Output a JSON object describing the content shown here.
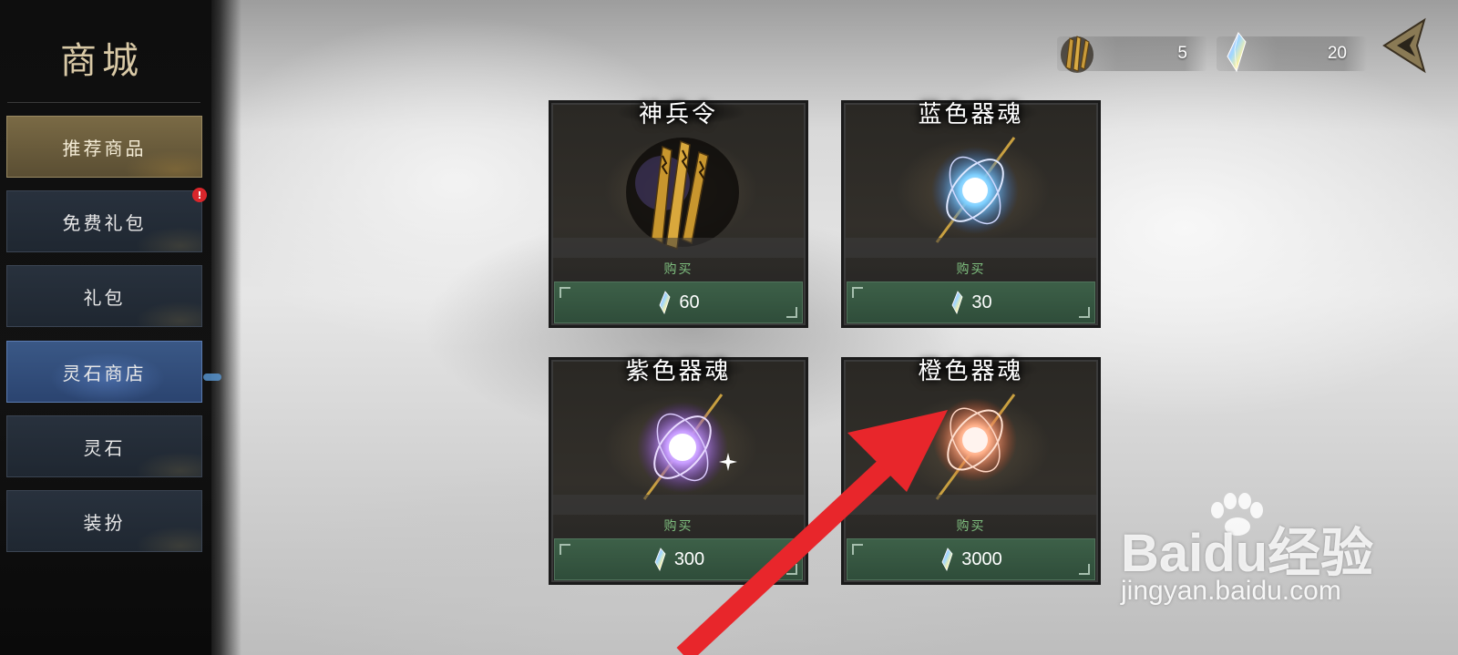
{
  "sidebar": {
    "title": "商城",
    "items": [
      {
        "label": "推荐商品",
        "state": "highlighted"
      },
      {
        "label": "免费礼包",
        "badge": "!"
      },
      {
        "label": "礼包"
      },
      {
        "label": "灵石商店",
        "state": "selected"
      },
      {
        "label": "灵石"
      },
      {
        "label": "装扮"
      }
    ]
  },
  "currency": {
    "tokens": {
      "icon": "golden-token-icon",
      "value": "5"
    },
    "spirit_stones": {
      "icon": "crystal-icon",
      "value": "20"
    }
  },
  "products": [
    {
      "name": "神兵令",
      "buy_label": "购买",
      "price": "60",
      "price_icon": "crystal-icon"
    },
    {
      "name": "蓝色器魂",
      "buy_label": "购买",
      "price": "30",
      "price_icon": "crystal-icon"
    },
    {
      "name": "紫色器魂",
      "buy_label": "购买",
      "price": "300",
      "price_icon": "crystal-icon"
    },
    {
      "name": "橙色器魂",
      "buy_label": "购买",
      "price": "3000",
      "price_icon": "crystal-icon"
    }
  ],
  "watermark": {
    "brand": "Baidu经验",
    "url": "jingyan.baidu.com"
  },
  "colors": {
    "accent_gold": "#d9c9a6",
    "buy_green": "#3d6048",
    "buy_label_green": "#7fbf7f",
    "selected_blue": "#3a5886",
    "annotation_red": "#e8262b"
  }
}
